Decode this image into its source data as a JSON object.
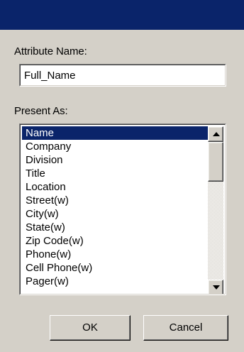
{
  "dialog": {
    "attribute_name_label": "Attribute Name:",
    "attribute_name_value": "Full_Name",
    "present_as_label": "Present As:",
    "present_as_options": [
      "Name",
      "Company",
      "Division",
      "Title",
      "Location",
      "Street(w)",
      "City(w)",
      "State(w)",
      "Zip Code(w)",
      "Phone(w)",
      "Cell Phone(w)",
      "Pager(w)"
    ],
    "present_as_selected": "Name",
    "ok_label": "OK",
    "cancel_label": "Cancel"
  },
  "colors": {
    "title_bar": "#0a246a",
    "dialog_face": "#d4d0c8",
    "selection": "#0a246a",
    "selection_text": "#ffffff"
  },
  "icons": {
    "scroll_up": "triangle-up-icon",
    "scroll_down": "triangle-down-icon"
  }
}
